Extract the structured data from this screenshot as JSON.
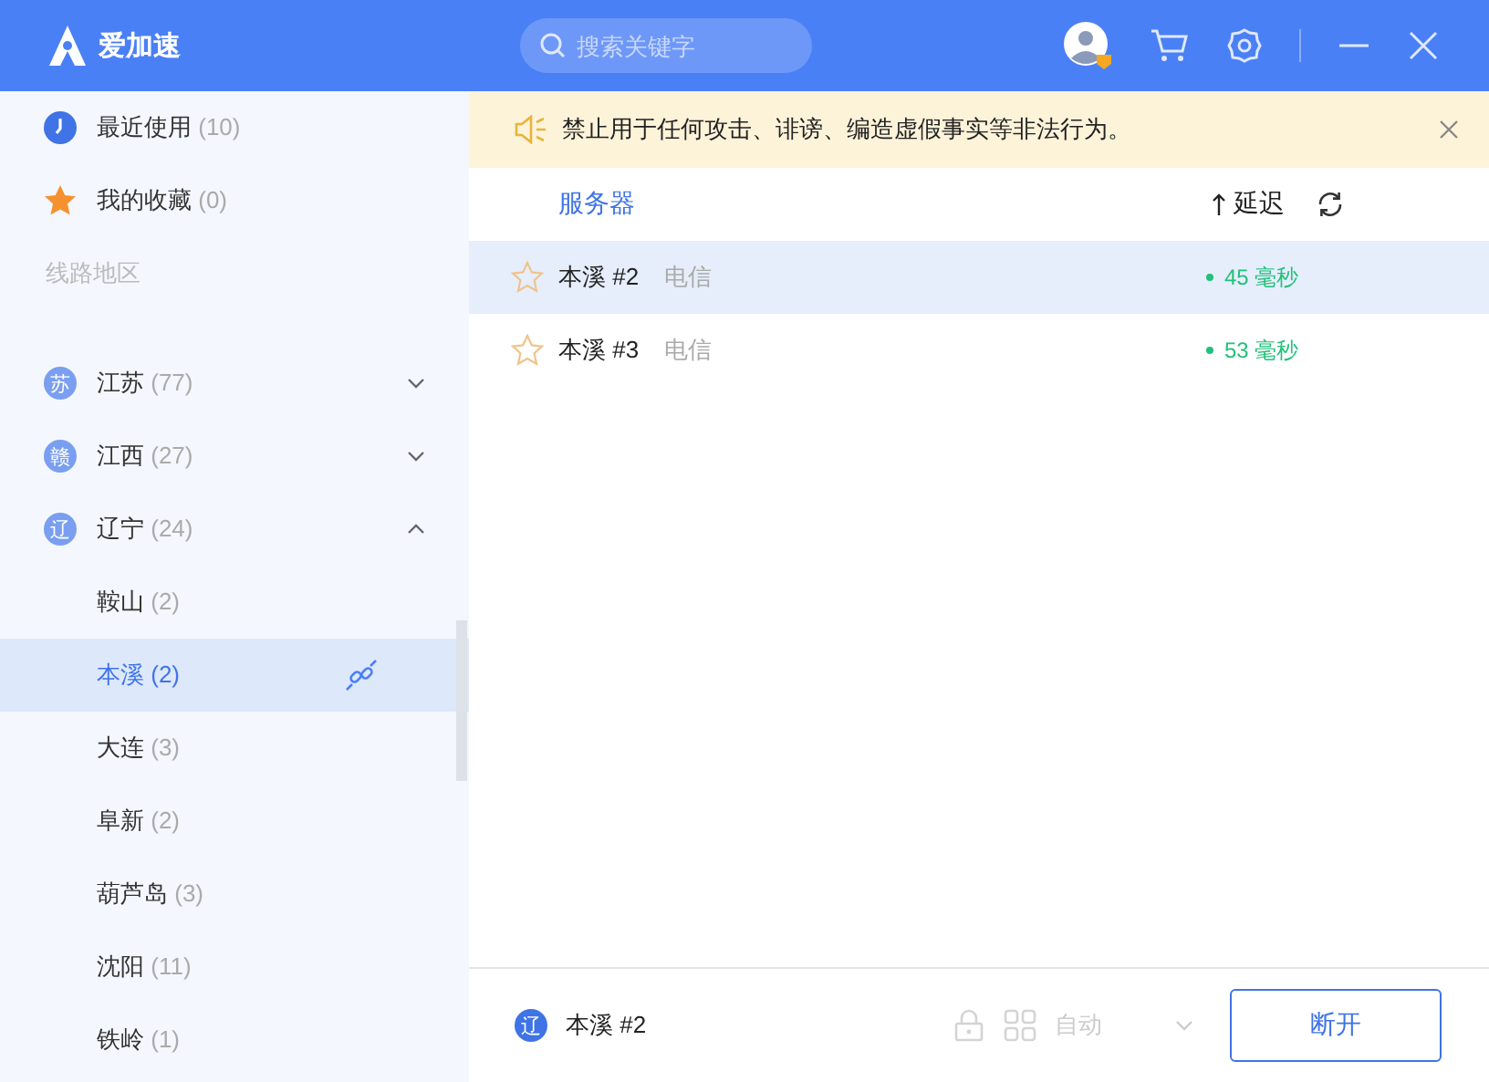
{
  "app": {
    "logo_text": "爱加速"
  },
  "search": {
    "placeholder": "搜索关键字"
  },
  "sidebar": {
    "quick_items": [
      {
        "kind": "recent",
        "label": "最近使用",
        "count": "(10)"
      },
      {
        "kind": "favorites",
        "label": "我的收藏",
        "count": "(0)"
      }
    ],
    "section_label": "线路地区",
    "regions": [
      {
        "badge": "苏",
        "name": "江苏",
        "count": "(77)",
        "expanded": false
      },
      {
        "badge": "赣",
        "name": "江西",
        "count": "(27)",
        "expanded": false
      },
      {
        "badge": "辽",
        "name": "辽宁",
        "count": "(24)",
        "expanded": true,
        "children": [
          {
            "name": "鞍山",
            "count": "(2)",
            "selected": false
          },
          {
            "name": "本溪",
            "count": "(2)",
            "selected": true
          },
          {
            "name": "大连",
            "count": "(3)",
            "selected": false
          },
          {
            "name": "阜新",
            "count": "(2)",
            "selected": false
          },
          {
            "name": "葫芦岛",
            "count": "(3)",
            "selected": false
          },
          {
            "name": "沈阳",
            "count": "(11)",
            "selected": false
          },
          {
            "name": "铁岭",
            "count": "(1)",
            "selected": false
          }
        ]
      }
    ]
  },
  "notice": {
    "text": "禁止用于任何攻击、诽谤、编造虚假事实等非法行为。"
  },
  "server_table": {
    "column_header": "服务器",
    "sort_label": "延迟",
    "rows": [
      {
        "name": "本溪 #2",
        "isp": "电信",
        "latency": "45 毫秒",
        "selected": true,
        "favorited": false
      },
      {
        "name": "本溪 #3",
        "isp": "电信",
        "latency": "53 毫秒",
        "selected": false,
        "favorited": false
      }
    ]
  },
  "footer": {
    "badge": "辽",
    "server": "本溪 #2",
    "mode": "自动",
    "button": "断开"
  }
}
